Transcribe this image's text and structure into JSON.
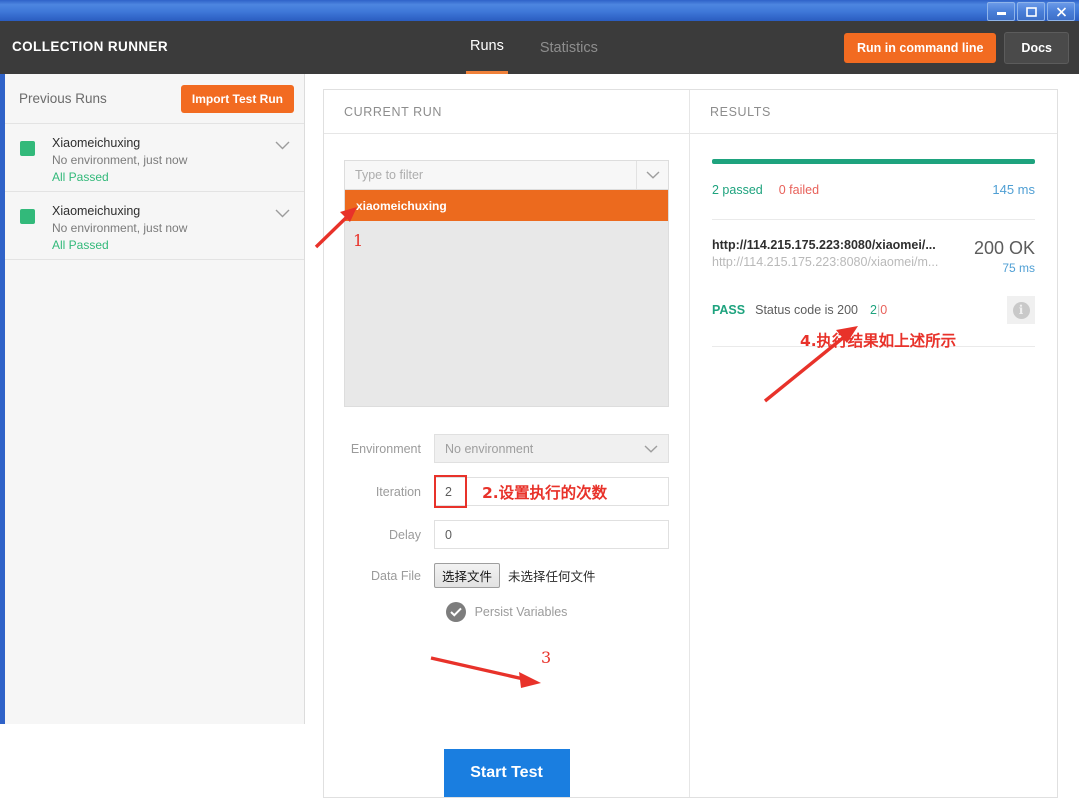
{
  "window": {
    "buttons": [
      {
        "name": "minimize",
        "glyph": "minimize-icon"
      },
      {
        "name": "maximize",
        "glyph": "maximize-icon"
      },
      {
        "name": "close",
        "glyph": "close-icon"
      }
    ]
  },
  "header": {
    "title": "COLLECTION RUNNER",
    "tabs": [
      {
        "label": "Runs",
        "active": true
      },
      {
        "label": "Statistics",
        "active": false
      }
    ],
    "run_cmd_label": "Run in command line",
    "docs_label": "Docs",
    "accent_orange": "#f26b21",
    "bar_bg": "#3b3b3b"
  },
  "sidebar": {
    "title": "Previous Runs",
    "import_label": "Import Test Run",
    "runs": [
      {
        "name": "Xiaomeichuxing",
        "meta": "No environment, just now",
        "status": "All Passed",
        "status_color": "#32b97a"
      },
      {
        "name": "Xiaomeichuxing",
        "meta": "No environment, just now",
        "status": "All Passed",
        "status_color": "#32b97a"
      }
    ]
  },
  "current_run": {
    "panel_title": "CURRENT RUN",
    "filter_placeholder": "Type to filter",
    "filter_value": "",
    "list_items": [
      {
        "label": "xiaomeichuxing",
        "selected": true
      }
    ],
    "form": {
      "environment_label": "Environment",
      "environment_value": "No environment",
      "iteration_label": "Iteration",
      "iteration_value": "2",
      "delay_label": "Delay",
      "delay_value": "0",
      "data_file_label": "Data File",
      "data_file_button": "选择文件",
      "data_file_status": "未选择任何文件",
      "persist_label": "Persist Variables",
      "persist_checked": true
    },
    "start_label": "Start Test"
  },
  "results": {
    "panel_title": "RESULTS",
    "progress_color": "#1ea37e",
    "passed_text": "2 passed",
    "failed_text": "0 failed",
    "total_time": "145 ms",
    "request": {
      "url_primary": "http://114.215.175.223:8080/xiaomei/...",
      "url_secondary": "http://114.215.175.223:8080/xiaomei/m...",
      "status_code": "200 OK",
      "response_time": "75 ms"
    },
    "assertion": {
      "verdict": "PASS",
      "name": "Status code is 200",
      "pass_count": "2",
      "separator": "|",
      "fail_count": "0",
      "info_glyph": "i"
    }
  },
  "annotations": {
    "color": "#e8322a",
    "markers": [
      {
        "id": "1",
        "text": "1"
      },
      {
        "id": "3",
        "text": "3"
      }
    ],
    "note_iteration": "2.设置执行的次数",
    "note_results": "4.执行结果如上述所示"
  }
}
